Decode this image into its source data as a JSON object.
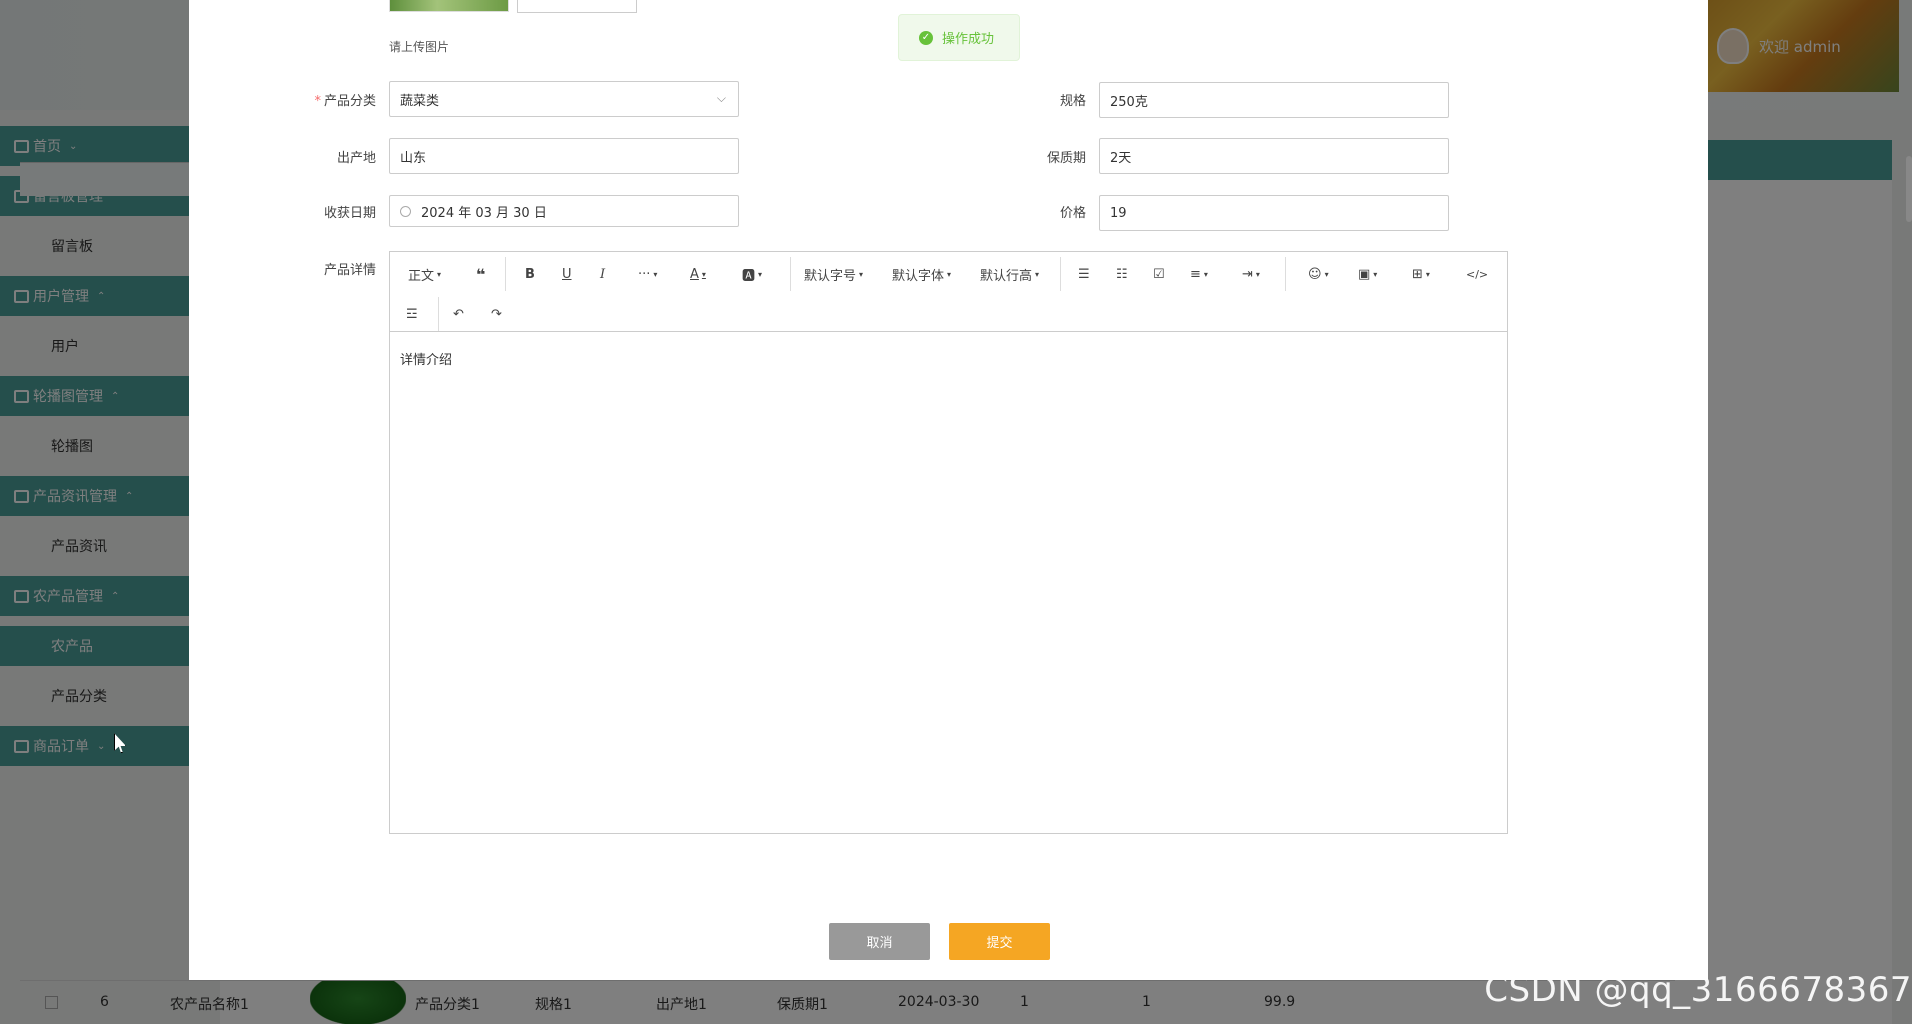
{
  "header": {
    "welcome": "欢迎 admin"
  },
  "sidebar": {
    "items": [
      {
        "type": "group",
        "label": "首页",
        "caret": "⌄"
      },
      {
        "type": "group",
        "label": "留言板管理",
        "caret": "⌃"
      },
      {
        "type": "sub",
        "label": "留言板"
      },
      {
        "type": "group",
        "label": "用户管理",
        "caret": "⌃"
      },
      {
        "type": "sub",
        "label": "用户"
      },
      {
        "type": "group",
        "label": "轮播图管理",
        "caret": "⌃"
      },
      {
        "type": "sub",
        "label": "轮播图"
      },
      {
        "type": "group",
        "label": "产品资讯管理",
        "caret": "⌃"
      },
      {
        "type": "sub",
        "label": "产品资讯"
      },
      {
        "type": "group",
        "label": "农产品管理",
        "caret": "⌃"
      },
      {
        "type": "sub",
        "label": "农产品",
        "active": true
      },
      {
        "type": "sub",
        "label": "产品分类"
      },
      {
        "type": "group",
        "label": "商品订单",
        "caret": "⌄"
      }
    ]
  },
  "table_row": {
    "index": "6",
    "name": "农产品名称1",
    "category": "产品分类1",
    "spec": "规格1",
    "origin": "出产地1",
    "shelf_life": "保质期1",
    "date": "2024-03-30",
    "col1": "1",
    "col2": "1",
    "price": "99.9"
  },
  "dialog": {
    "upload_tip": "请上传图片",
    "toast": "操作成功",
    "fields": {
      "category_label": "产品分类",
      "category_value": "蔬菜类",
      "spec_label": "规格",
      "spec_value": "250克",
      "origin_label": "出产地",
      "origin_value": "山东",
      "shelf_life_label": "保质期",
      "shelf_life_value": "2天",
      "harvest_label": "收获日期",
      "harvest_value": "2024 年 03 月 30 日",
      "price_label": "价格",
      "price_value": "19",
      "detail_label": "产品详情"
    },
    "editor": {
      "paragraph": "正文",
      "font_size": "默认字号",
      "font_family": "默认字体",
      "line_height": "默认行高",
      "content": "详情介绍"
    },
    "buttons": {
      "cancel": "取消",
      "submit": "提交"
    }
  },
  "watermark": "CSDN @qq_3166678367",
  "colors": {
    "primary": "#4a9e98",
    "submit": "#f5a623",
    "cancel": "#999999",
    "success": "#67c23a"
  }
}
